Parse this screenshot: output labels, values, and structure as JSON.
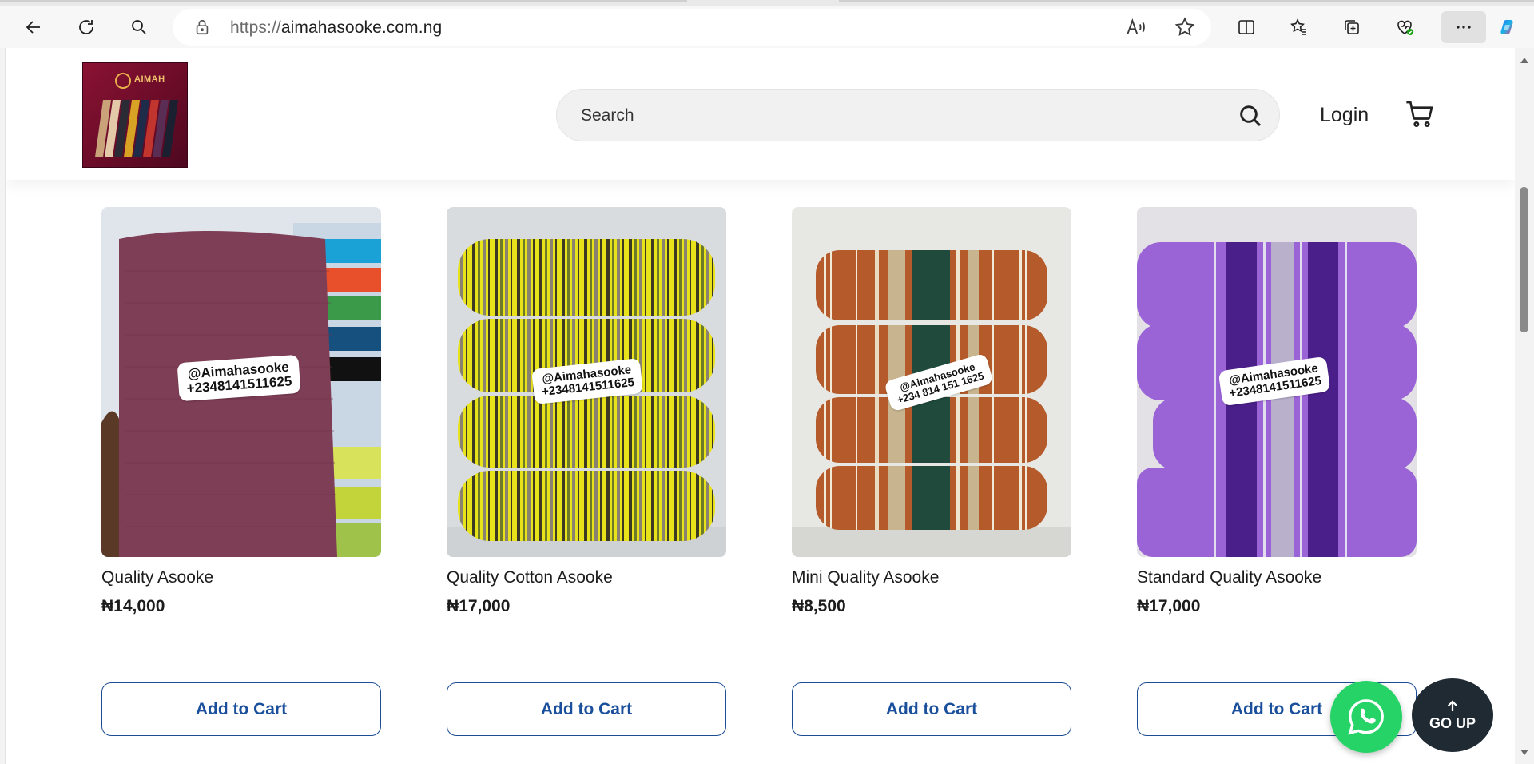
{
  "browser": {
    "url_protocol": "https://",
    "url_host": "aimahasooke.com.ng"
  },
  "header": {
    "logo_text": "AIMAH",
    "search_placeholder": "Search",
    "login_label": "Login"
  },
  "products": [
    {
      "title": "Quality Asooke",
      "price": "₦14,000",
      "button": "Add to Cart",
      "tag_handle": "@Aimahasooke",
      "tag_phone": "+2348141511625"
    },
    {
      "title": "Quality Cotton Asooke",
      "price": "₦17,000",
      "button": "Add to Cart",
      "tag_handle": "@Aimahasooke",
      "tag_phone": "+2348141511625"
    },
    {
      "title": "Mini Quality Asooke",
      "price": "₦8,500",
      "button": "Add to Cart",
      "tag_handle": "@Aimahasooke",
      "tag_phone": "+234 814 151 1625"
    },
    {
      "title": "Standard Quality Asooke",
      "price": "₦17,000",
      "button": "Add to Cart",
      "tag_handle": "@Aimahasooke",
      "tag_phone": "+2348141511625"
    }
  ],
  "floating": {
    "go_up_label": "GO UP"
  },
  "colors": {
    "button_border": "#1b4d93",
    "button_text": "#1a4f9c",
    "whatsapp": "#25d366",
    "go_up_bg": "#1f2a33"
  }
}
